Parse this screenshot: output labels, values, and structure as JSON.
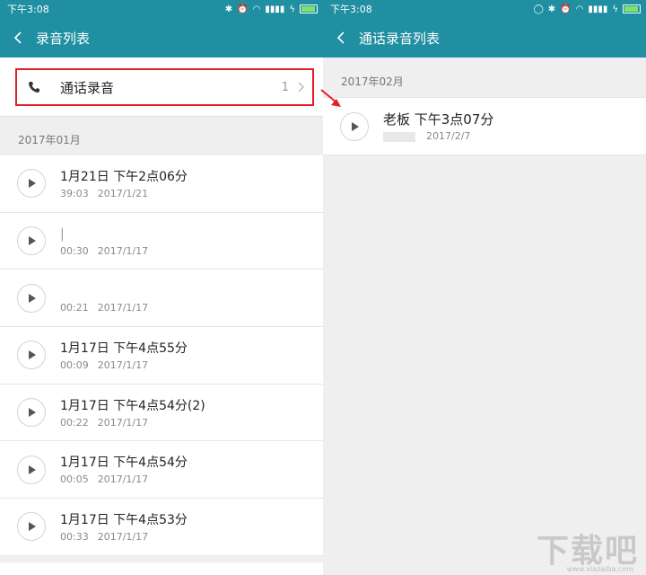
{
  "status": {
    "time": "下午3:08"
  },
  "left": {
    "title": "录音列表",
    "call_row": {
      "label": "通话录音",
      "count": "1"
    },
    "section_header": "2017年01月",
    "items": [
      {
        "title": "1月21日 下午2点06分",
        "duration": "39:03",
        "date": "2017/1/21"
      },
      {
        "title": "|",
        "duration": "00:30",
        "date": "2017/1/17"
      },
      {
        "title": "",
        "duration": "00:21",
        "date": "2017/1/17"
      },
      {
        "title": "1月17日 下午4点55分",
        "duration": "00:09",
        "date": "2017/1/17"
      },
      {
        "title": "1月17日 下午4点54分(2)",
        "duration": "00:22",
        "date": "2017/1/17"
      },
      {
        "title": "1月17日 下午4点54分",
        "duration": "00:05",
        "date": "2017/1/17"
      },
      {
        "title": "1月17日 下午4点53分",
        "duration": "00:33",
        "date": "2017/1/17"
      }
    ]
  },
  "right": {
    "title": "通话录音列表",
    "section_header": "2017年02月",
    "items": [
      {
        "title": "老板 下午3点07分",
        "date": "2017/2/7"
      }
    ]
  },
  "watermark": {
    "text": "下载吧",
    "url": "www.xiazaiba.com"
  },
  "colors": {
    "appbar": "#1f8fa1",
    "highlight": "#e21e26"
  }
}
